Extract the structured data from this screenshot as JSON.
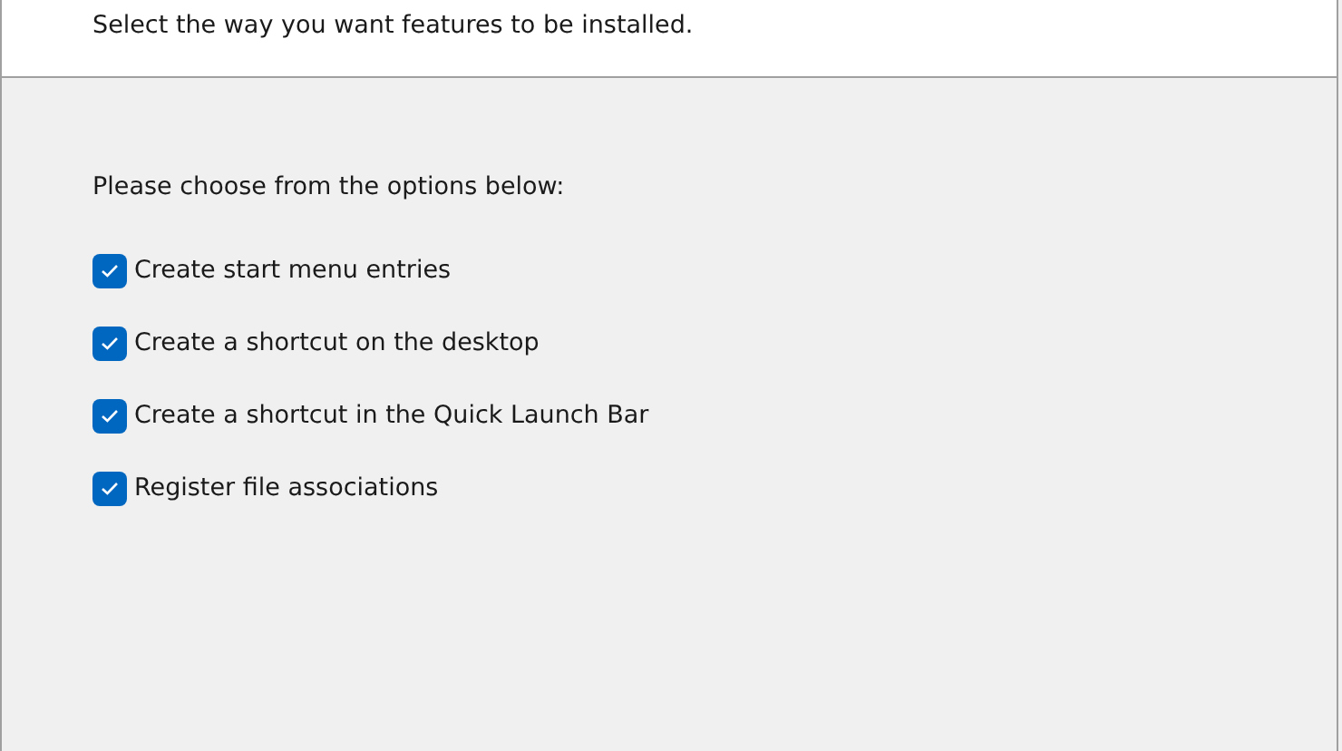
{
  "header": {
    "subtitle": "Select the way you want features to be installed."
  },
  "prompt": "Please choose from the options below:",
  "options": [
    {
      "label": "Create start menu entries",
      "checked": true
    },
    {
      "label": "Create a shortcut on the desktop",
      "checked": true
    },
    {
      "label": "Create a shortcut in the Quick Launch Bar",
      "checked": true
    },
    {
      "label": "Register file associations",
      "checked": true
    }
  ]
}
